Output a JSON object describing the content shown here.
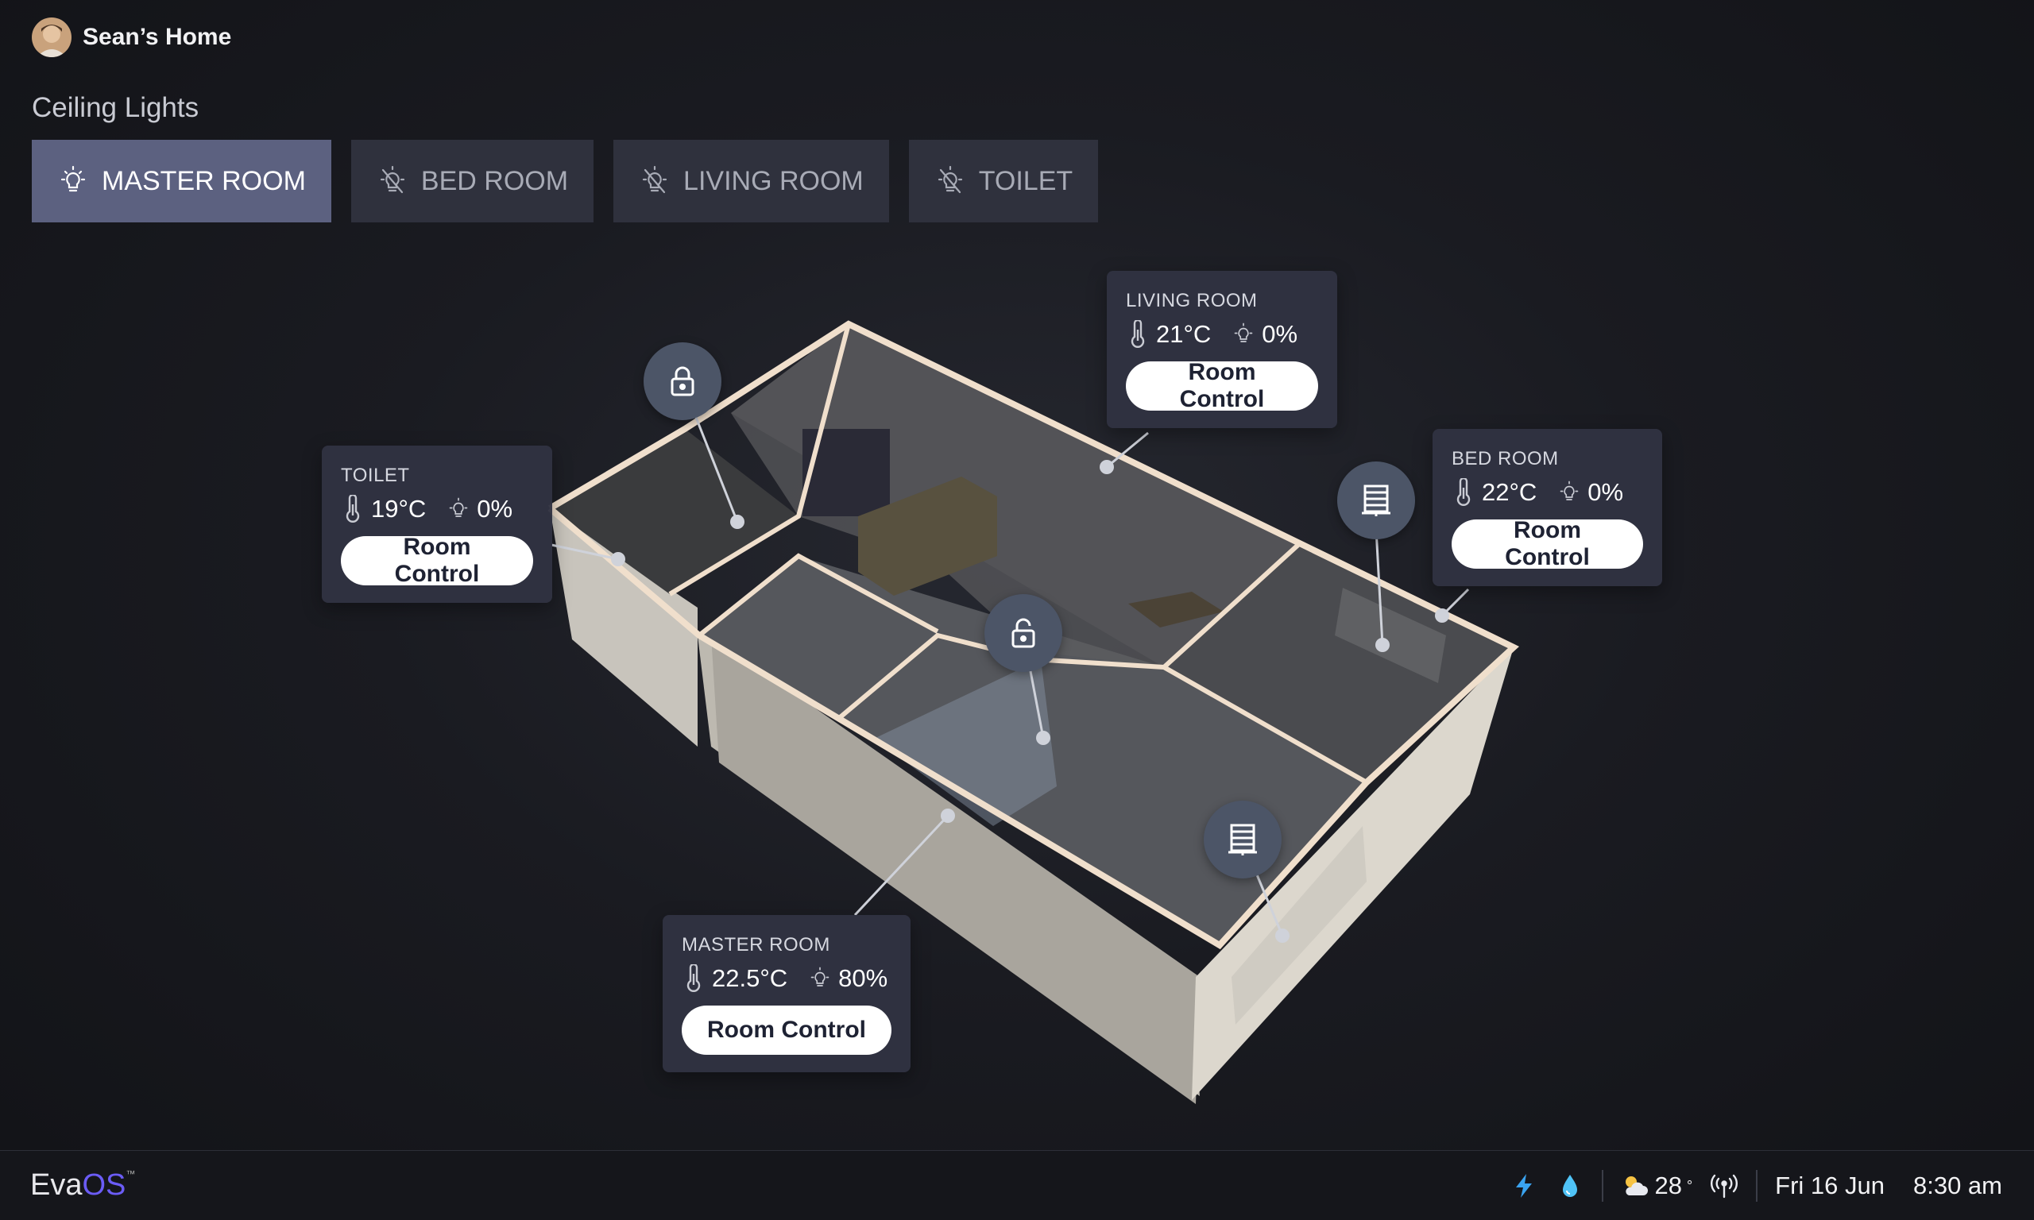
{
  "header": {
    "home_name": "Sean’s Home"
  },
  "section_title": "Ceiling Lights",
  "tabs": [
    {
      "label": "MASTER ROOM",
      "active": true,
      "icon": "bulb-on-icon"
    },
    {
      "label": "BED ROOM",
      "active": false,
      "icon": "bulb-off-icon"
    },
    {
      "label": "LIVING ROOM",
      "active": false,
      "icon": "bulb-off-icon"
    },
    {
      "label": "TOILET",
      "active": false,
      "icon": "bulb-off-icon"
    }
  ],
  "rooms": {
    "living": {
      "name": "LIVING ROOM",
      "temp": "21°C",
      "light": "0%",
      "button": "Room Control"
    },
    "bed": {
      "name": "BED ROOM",
      "temp": "22°C",
      "light": "0%",
      "button": "Room Control"
    },
    "toilet": {
      "name": "TOILET",
      "temp": "19°C",
      "light": "0%",
      "button": "Room Control"
    },
    "master": {
      "name": "MASTER ROOM",
      "temp": "22.5°C",
      "light": "80%",
      "button": "Room Control"
    }
  },
  "devices": [
    {
      "icon": "lock-icon",
      "room": "toilet"
    },
    {
      "icon": "unlock-icon",
      "room": "master"
    },
    {
      "icon": "window-blinds-icon",
      "room": "bed"
    },
    {
      "icon": "window-blinds-icon",
      "room": "master"
    }
  ],
  "footer": {
    "brand_a": "Eva",
    "brand_b": "OS",
    "brand_tm": "™",
    "temperature": "28",
    "degree": "°",
    "date": "Fri 16 Jun",
    "time": "8:30 am"
  },
  "colors": {
    "accent": "#6b5cf6",
    "tab_active": "#5c6180",
    "tab_inactive": "#2f313d",
    "card_bg": "#303242",
    "device_bg": "#4c5567"
  }
}
